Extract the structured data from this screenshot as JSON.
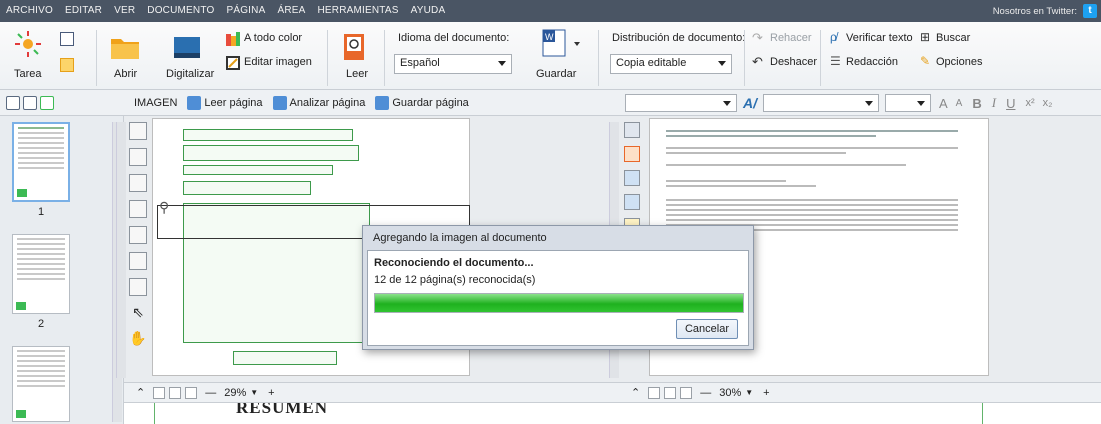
{
  "menu": {
    "items": [
      "ARCHIVO",
      "EDITAR",
      "VER",
      "DOCUMENTO",
      "PÁGINA",
      "ÁREA",
      "HERRAMIENTAS",
      "AYUDA"
    ],
    "twitter": "Nosotros en Twitter:"
  },
  "ribbon": {
    "tarea": "Tarea",
    "abrir": "Abrir",
    "digitalizar": "Digitalizar",
    "a_todo_color": "A todo color",
    "editar_imagen": "Editar imagen",
    "leer": "Leer",
    "idioma_label": "Idioma del documento:",
    "idioma_value": "Español",
    "guardar": "Guardar",
    "distribucion_label": "Distribución de documento:",
    "distribucion_value": "Copia editable",
    "rehacer": "Rehacer",
    "deshacer": "Deshacer",
    "verificar_texto": "Verificar texto",
    "buscar": "Buscar",
    "redaccion": "Redacción",
    "opciones": "Opciones"
  },
  "toolbar2": {
    "imagen": "IMAGEN",
    "leer_pagina": "Leer página",
    "analizar_pagina": "Analizar página",
    "guardar_pagina": "Guardar página"
  },
  "format": {
    "a_big": "A",
    "a_small": "A",
    "bold": "B",
    "italic": "I",
    "underline": "U",
    "superscript": "x²",
    "subscript": "x₂"
  },
  "thumbnails": [
    {
      "label": "1"
    },
    {
      "label": "2"
    }
  ],
  "zoom": {
    "image_pane": "29%",
    "text_pane": "30%",
    "minus": "—",
    "plus": "+"
  },
  "doc": {
    "resumen": "RESUMEN"
  },
  "dialog": {
    "title": "Agregando la imagen al documento",
    "heading": "Reconociendo el documento...",
    "status": "12 de 12 página(s) reconocida(s)",
    "progress": 1.0,
    "cancel": "Cancelar"
  },
  "colors": {
    "menubar": "#4a5564",
    "progress": "#22b522",
    "zone": "#3d9a4b",
    "twitter": "#1da1f2"
  }
}
